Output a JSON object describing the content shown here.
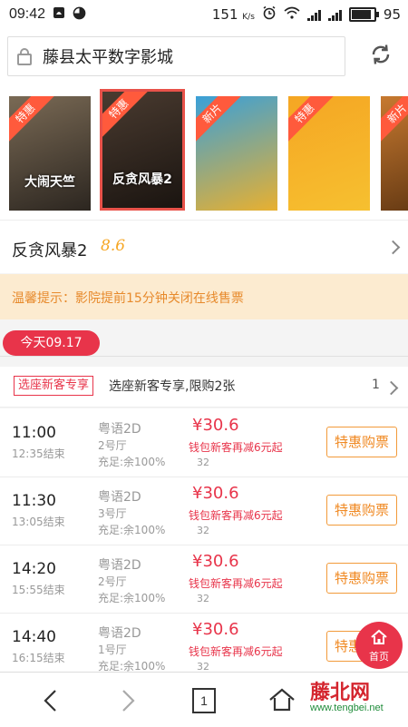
{
  "status_bar": {
    "time": "09:42",
    "network_speed": "151",
    "speed_unit": "K/s",
    "battery": "95"
  },
  "address_bar": {
    "title": "藤县太平数字影城"
  },
  "posters": [
    {
      "ribbon": "特惠",
      "title": "大闹天竺",
      "selected": false,
      "colors": [
        "#7a6a55",
        "#2c2620"
      ]
    },
    {
      "ribbon": "特惠",
      "title": "反贪风暴2",
      "selected": true,
      "colors": [
        "#4a3b30",
        "#1a1410"
      ]
    },
    {
      "ribbon": "新片",
      "title": "",
      "selected": false,
      "colors": [
        "#3aa0d8",
        "#e8b030"
      ]
    },
    {
      "ribbon": "特惠",
      "title": "",
      "selected": false,
      "colors": [
        "#f5a623",
        "#f6c030"
      ]
    },
    {
      "ribbon": "新片",
      "title": "",
      "selected": false,
      "colors": [
        "#c77a30",
        "#5a3210"
      ]
    }
  ],
  "movie": {
    "title": "反贪风暴2",
    "score": "8.6"
  },
  "notice": "温馨提示：影院提前15分钟关闭在线售票",
  "date_tab": "今天09.17",
  "promo": {
    "tag": "选座新客专享",
    "text": "选座新客专享,限购2张",
    "count": "1"
  },
  "shows": [
    {
      "start": "11:00",
      "end": "12:35结束",
      "lang": "粤语2D",
      "hall": "2号厅",
      "seats": "充足:余100%",
      "price": "¥30.6",
      "discount": "钱包新客再减6元起",
      "orig": "32",
      "buy": "特惠购票"
    },
    {
      "start": "11:30",
      "end": "13:05结束",
      "lang": "粤语2D",
      "hall": "3号厅",
      "seats": "充足:余100%",
      "price": "¥30.6",
      "discount": "钱包新客再减6元起",
      "orig": "32",
      "buy": "特惠购票"
    },
    {
      "start": "14:20",
      "end": "15:55结束",
      "lang": "粤语2D",
      "hall": "2号厅",
      "seats": "充足:余100%",
      "price": "¥30.6",
      "discount": "钱包新客再减6元起",
      "orig": "32",
      "buy": "特惠购票"
    },
    {
      "start": "14:40",
      "end": "16:15结束",
      "lang": "粤语2D",
      "hall": "1号厅",
      "seats": "充足:余100%",
      "price": "¥30.6",
      "discount": "钱包新客再减6元起",
      "orig": "32",
      "buy": "特惠购票"
    }
  ],
  "home_button": {
    "label": "首页"
  },
  "bottom_nav": {
    "tab_count": "1"
  },
  "watermark": {
    "name": "藤北网",
    "url": "www.tengbei.net"
  },
  "colors": {
    "accent": "#e8344a",
    "orange": "#f08a24",
    "notice_bg": "#fcebd0",
    "score": "#f6a623"
  }
}
